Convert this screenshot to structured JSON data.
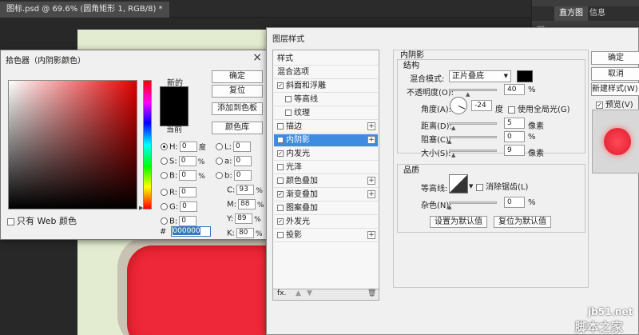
{
  "document_tab": "图标.psd @ 69.6% (圆角矩形 1, RGB/8) *",
  "panels": {
    "tabs": [
      "直方图",
      "信息"
    ]
  },
  "color_picker": {
    "title": "拾色器（内阴影颜色）",
    "new_label": "新的",
    "current_label": "当前",
    "buttons": {
      "ok": "确定",
      "reset": "复位",
      "add_swatch": "添加到色板",
      "libraries": "颜色库"
    },
    "web_only": "只有 Web 颜色",
    "fields": {
      "H": {
        "label": "H:",
        "value": "0",
        "unit": "度"
      },
      "S": {
        "label": "S:",
        "value": "0",
        "unit": "%"
      },
      "Bv": {
        "label": "B:",
        "value": "0",
        "unit": "%"
      },
      "R": {
        "label": "R:",
        "value": "0",
        "unit": ""
      },
      "G": {
        "label": "G:",
        "value": "0",
        "unit": ""
      },
      "Bb": {
        "label": "B:",
        "value": "0",
        "unit": ""
      },
      "L": {
        "label": "L:",
        "value": "0",
        "unit": ""
      },
      "a": {
        "label": "a:",
        "value": "0",
        "unit": ""
      },
      "b": {
        "label": "b:",
        "value": "0",
        "unit": ""
      },
      "C": {
        "label": "C:",
        "value": "93",
        "unit": "%"
      },
      "M": {
        "label": "M:",
        "value": "88",
        "unit": "%"
      },
      "Y": {
        "label": "Y:",
        "value": "89",
        "unit": "%"
      },
      "K": {
        "label": "K:",
        "value": "80",
        "unit": "%"
      }
    },
    "hex_label": "#",
    "hex_value": "000000",
    "new_color": "#000000"
  },
  "layer_style": {
    "title": "图层样式",
    "list": {
      "styles_header": "样式",
      "blend_options": "混合选项",
      "bevel": "斜面和浮雕",
      "contour": "等高线",
      "texture": "纹理",
      "stroke": "描边",
      "inner_shadow": "内阴影",
      "inner_glow": "内发光",
      "satin": "光泽",
      "color_overlay": "颜色叠加",
      "gradient_overlay": "渐变叠加",
      "pattern_overlay": "图案叠加",
      "outer_glow": "外发光",
      "drop_shadow": "投影",
      "fx": "fx."
    },
    "panel": {
      "title": "内阴影",
      "structure": "结构",
      "blend_mode_label": "混合模式:",
      "blend_mode_value": "正片叠底",
      "opacity_label": "不透明度(O):",
      "opacity_value": "40",
      "angle_label": "角度(A):",
      "angle_value": "-24",
      "angle_unit": "度",
      "global_light": "使用全局光(G)",
      "distance_label": "距离(D):",
      "distance_value": "5",
      "choke_label": "阻塞(C):",
      "choke_value": "0",
      "size_label": "大小(S):",
      "size_value": "9",
      "unit_px": "像素",
      "unit_pct": "%",
      "quality": "品质",
      "contour_label": "等高线:",
      "anti_alias": "消除锯齿(L)",
      "noise_label": "杂色(N):",
      "noise_value": "0",
      "make_default": "设置为默认值",
      "reset_default": "复位为默认值"
    },
    "buttons": {
      "ok": "确定",
      "cancel": "取消",
      "new_style": "新建样式(W)...",
      "preview": "预览(V)"
    }
  },
  "watermark": {
    "url": "jb51.net",
    "name": "脚本之家"
  },
  "colors": {
    "selection": "#3d8ce2",
    "red_shape": "#ee2838",
    "shadow_color": "#000000"
  }
}
